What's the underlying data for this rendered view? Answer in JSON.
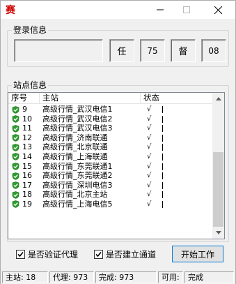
{
  "window": {
    "title_icon": "red-seal-app-icon",
    "minimize_icon": "minimize-icon",
    "maximize_icon": "maximize-icon",
    "close_icon": "close-icon"
  },
  "login_group": {
    "title": "登录信息",
    "display_value": "",
    "stats": [
      "任",
      "75",
      "督",
      "08"
    ]
  },
  "site_group": {
    "title": "站点信息",
    "columns": {
      "no": "序号",
      "site": "主站",
      "status": "状态"
    },
    "rows": [
      {
        "no": "9",
        "site": "高级行情_武汉电信1",
        "status": "√"
      },
      {
        "no": "10",
        "site": "高级行情_武汉电信2",
        "status": "√"
      },
      {
        "no": "11",
        "site": "高级行情_武汉电信3",
        "status": "√"
      },
      {
        "no": "12",
        "site": "高级行情_济南联通",
        "status": "√"
      },
      {
        "no": "13",
        "site": "高级行情_北京联通",
        "status": "√"
      },
      {
        "no": "14",
        "site": "高级行情_上海联通",
        "status": "√"
      },
      {
        "no": "15",
        "site": "高级行情_东莞联通1",
        "status": "√"
      },
      {
        "no": "16",
        "site": "高级行情_东莞联通2",
        "status": "√"
      },
      {
        "no": "17",
        "site": "高级行情_深圳电信3",
        "status": "√"
      },
      {
        "no": "18",
        "site": "高级行情_北京主站",
        "status": "√"
      },
      {
        "no": "19",
        "site": "高级行情_上海电信5",
        "status": "√"
      }
    ]
  },
  "controls": {
    "verify_proxy_label": "是否验证代理",
    "verify_proxy_checked": true,
    "build_channel_label": "是否建立通道",
    "build_channel_checked": true,
    "start_button": "开始工作"
  },
  "statusbar": {
    "site": "主站: 18",
    "proxy": "代理: 973",
    "done": "完成: 973",
    "available": "可用: 14",
    "state": "完成"
  }
}
